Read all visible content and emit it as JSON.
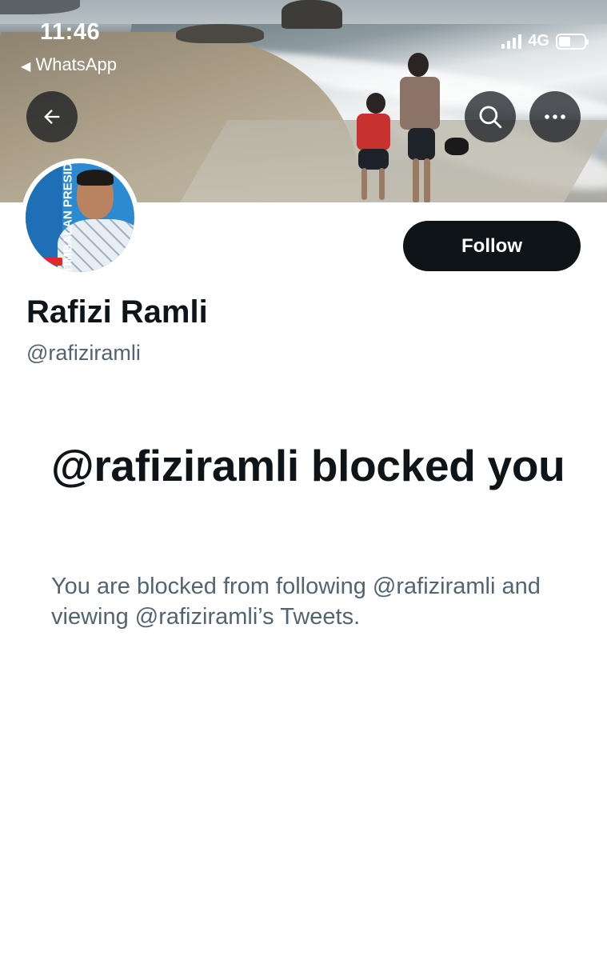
{
  "status_bar": {
    "time": "11:46",
    "back_app": "WhatsApp",
    "network": "4G",
    "icons": [
      "signal-bars-icon",
      "battery-icon"
    ]
  },
  "header": {
    "back_icon": "arrow-left-icon",
    "search_icon": "search-icon",
    "more_icon": "more-horizontal-icon"
  },
  "profile": {
    "name": "Rafizi Ramli",
    "handle": "@rafiziramli",
    "follow_label": "Follow",
    "avatar_text": "TIMBALAN PRESIDEN"
  },
  "blocked": {
    "title": "@rafiziramli blocked you",
    "description": "You are blocked from following @rafiziramli and viewing @rafiziramli’s Tweets."
  },
  "colors": {
    "primary_text": "#0f1419",
    "secondary_text": "#536471",
    "button_bg": "#0f1419"
  }
}
